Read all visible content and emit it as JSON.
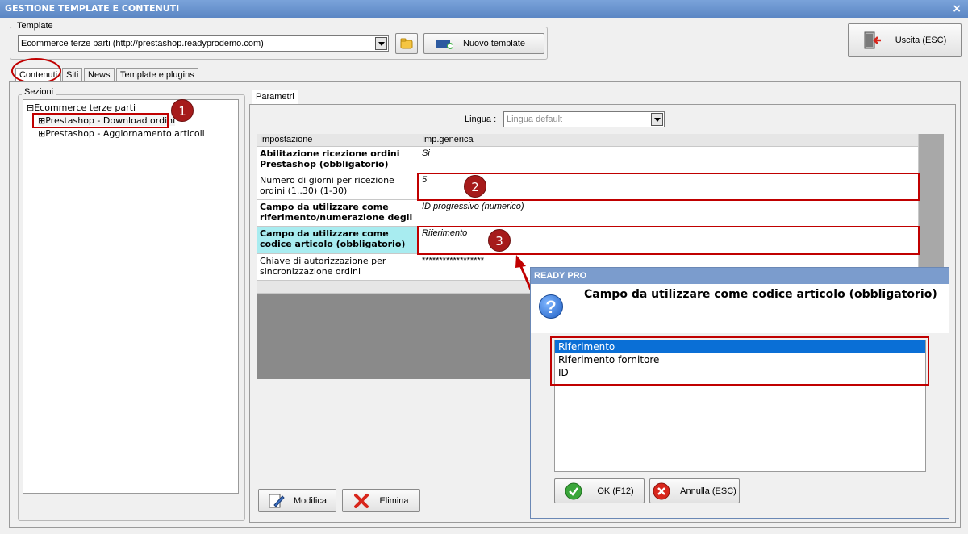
{
  "window": {
    "title": "GESTIONE TEMPLATE E CONTENUTI",
    "close_glyph": "×"
  },
  "template": {
    "legend": "Template",
    "selected": "Ecommerce terze parti (http://prestashop.readyprodemo.com)",
    "new_button": "Nuovo template"
  },
  "exit_button": "Uscita (ESC)",
  "tabs": [
    "Contenuti",
    "Siti",
    "News",
    "Template e plugins"
  ],
  "sections": {
    "legend": "Sezioni",
    "root": "Ecommerce terze parti",
    "items": [
      "Prestashop - Download ordini",
      "Prestashop - Aggiornamento articoli"
    ]
  },
  "params": {
    "tab": "Parametri",
    "lingua_label": "Lingua :",
    "lingua_value": "Lingua default",
    "headers": [
      "Impostazione",
      "Imp.generica"
    ],
    "rows": [
      {
        "label": "Abilitazione ricezione ordini Prestashop (obbligatorio)",
        "value": "Si"
      },
      {
        "label": "Numero di giorni per ricezione ordini (1..30) (1-30)",
        "value": "5"
      },
      {
        "label": "Campo da utilizzare come riferimento/numerazione degli o...",
        "value": "ID progressivo (numerico)"
      },
      {
        "label": "Campo da utilizzare come codice articolo (obbligatorio)",
        "value": "Riferimento"
      },
      {
        "label": "Chiave di autorizzazione per sincronizzazione ordini",
        "value": "******************"
      }
    ],
    "modifica": "Modifica",
    "elimina": "Elimina"
  },
  "badges": [
    "1",
    "2",
    "3"
  ],
  "dialog": {
    "title": "READY PRO",
    "question": "Campo da utilizzare come codice articolo (obbligatorio)",
    "question_icon": "?",
    "options": [
      "Riferimento",
      "Riferimento fornitore",
      "ID"
    ],
    "ok": "OK (F12)",
    "cancel": "Annulla (ESC)"
  },
  "colors": {
    "accent_red": "#c00000",
    "selection_blue": "#0a6fd6",
    "highlight_cyan": "#a8ecf0"
  }
}
